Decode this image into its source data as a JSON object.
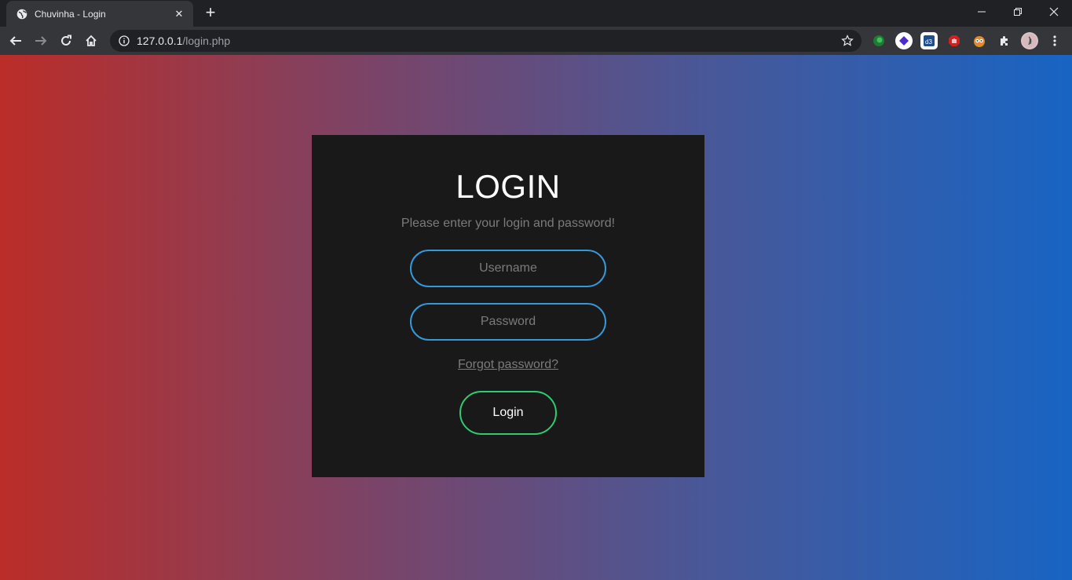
{
  "browser": {
    "tab_title": "Chuvinha - Login",
    "tab_icon": "globe-icon",
    "url_host": "127.0.0.1",
    "url_path": "/login.php",
    "accent": "#35363a"
  },
  "page": {
    "title": "LOGIN",
    "subtitle": "Please enter your login and password!",
    "username_placeholder": "Username",
    "password_placeholder": "Password",
    "forgot_link": "Forgot password?",
    "login_button": "Login",
    "colors": {
      "gradient_left": "#bb2d28",
      "gradient_right": "#1864c3",
      "card_bg": "#191919",
      "input_border": "#3498db",
      "button_border": "#2ecc71"
    }
  }
}
